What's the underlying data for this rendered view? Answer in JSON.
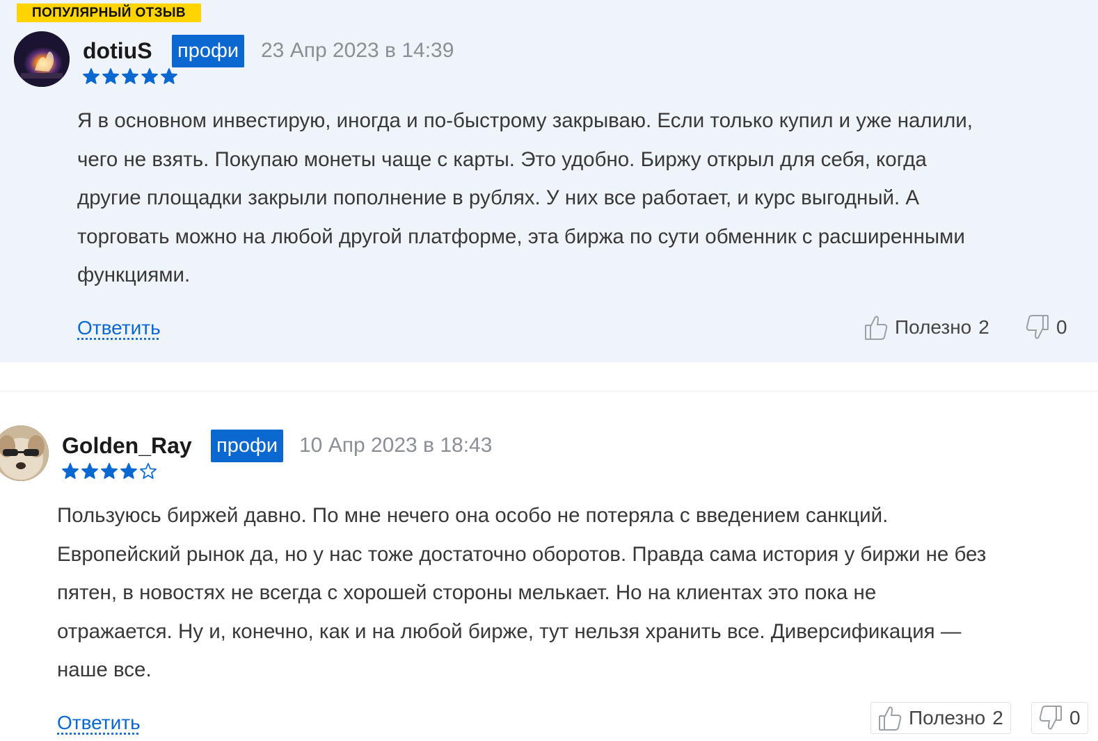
{
  "reviews": [
    {
      "badge": "ПОПУЛЯРНЫЙ ОТЗЫВ",
      "username": "dotiuS",
      "profi_label": "профи",
      "date": "23 Апр 2023 в 14:39",
      "rating": 5,
      "rating_max": 5,
      "text_lines": [
        "Я в основном инвестирую, иногда и по-быстрому закрываю. Если только купил и уже налили,",
        "чего не взять. Покупаю монеты чаще с карты. Это удобно. Биржу открыл для себя, когда",
        "другие площадки закрыли пополнение в рублях. У них все работает, и курс выгодный. А",
        "торговать можно на любой другой платформе, эта биржа по сути обменник с расширенными",
        "функциями."
      ],
      "reply_label": "Ответить",
      "helpful_label": "Полезно",
      "helpful_count": "2",
      "unhelpful_count": "0",
      "icons": {
        "helpful": "thumbs-up-icon",
        "unhelpful": "thumbs-down-icon",
        "star": "star-icon"
      }
    },
    {
      "username": "Golden_Ray",
      "profi_label": "профи",
      "date": "10 Апр 2023 в 18:43",
      "rating": 4,
      "rating_max": 5,
      "text_lines": [
        "Пользуюсь биржей давно. По мне нечего она особо не потеряла с введением санкций.",
        "Европейский рынок да, но у нас тоже достаточно оборотов. Правда сама история у биржи не без",
        "пятен, в новостях не всегда с хорошей стороны мелькает. Но на клиентах это пока не",
        "отражается. Ну и, конечно, как и на любой бирже, тут нельзя хранить все. Диверсификация —",
        "наше все."
      ],
      "reply_label": "Ответить",
      "helpful_label": "Полезно",
      "helpful_count": "2",
      "unhelpful_count": "0",
      "icons": {
        "helpful": "thumbs-up-icon",
        "unhelpful": "thumbs-down-icon",
        "star": "star-icon"
      }
    }
  ],
  "colors": {
    "accent": "#0a68d0",
    "badge_bg": "#ffd400",
    "highlight_bg": "#eff4fa",
    "star_fill": "#0a68d0"
  }
}
